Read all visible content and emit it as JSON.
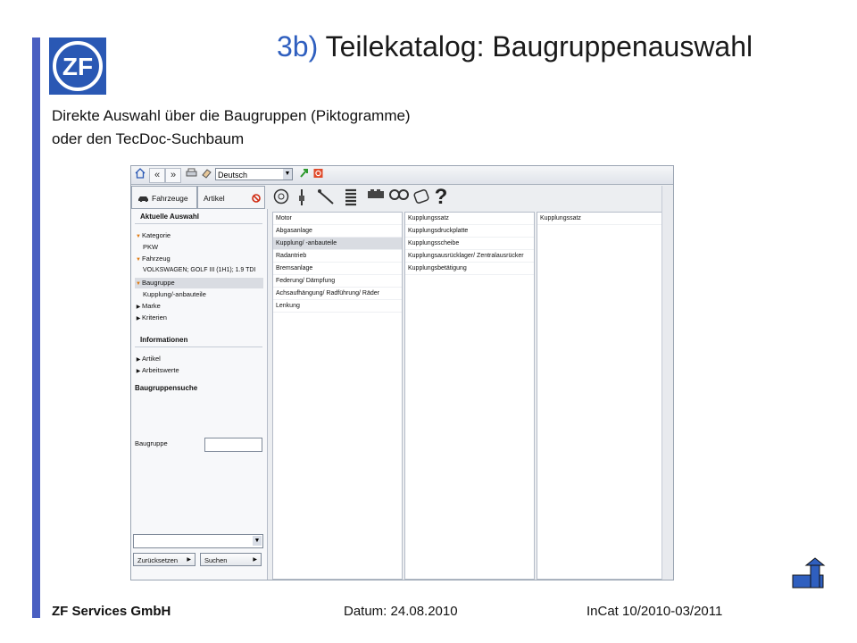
{
  "header": {
    "logo_text": "ZF",
    "title_number": "3b)",
    "title_text": "Teilekatalog: Baugruppenauswahl"
  },
  "subtitle": {
    "line1": "Direkte Auswahl über die Baugruppen (Piktogramme)",
    "line2": "oder den TecDoc-Suchbaum"
  },
  "app": {
    "toolbar": {
      "home_icon": "home-icon",
      "back_label": "«",
      "forward_label": "»",
      "print_icon": "print-icon",
      "eraser_icon": "eraser-icon",
      "language_value": "Deutsch",
      "refresh_icon": "refresh-icon",
      "exit_icon": "exit-icon"
    },
    "tabs": {
      "vehicles_label": "Fahrzeuge",
      "articles_label": "Artikel"
    },
    "left": {
      "current_selection_heading": "Aktuelle Auswahl",
      "tree": [
        {
          "label": "Kategorie",
          "expanded": true
        },
        {
          "label": "PKW",
          "child": true
        },
        {
          "label": "Fahrzeug",
          "expanded": true
        },
        {
          "label": "VOLKSWAGEN; GOLF III (1H1); 1.9 TDI",
          "child": true
        },
        {
          "label": "Baugruppe",
          "expanded": true,
          "selected": true
        },
        {
          "label": "Kupplung/-anbauteile",
          "child": true
        },
        {
          "label": "Marke",
          "expanded": false
        },
        {
          "label": "Kriterien",
          "expanded": false
        }
      ],
      "info_heading": "Informationen",
      "info_items": [
        "Artikel",
        "Arbeitswerte"
      ],
      "search_heading": "Baugruppensuche",
      "search_label": "Baugruppe",
      "search_value": "",
      "reset_button": "Zurücksetzen",
      "search_button": "Suchen"
    },
    "pictograms": [
      "brake-disc-icon",
      "shock-absorber-icon",
      "steering-icon",
      "spring-icon",
      "engine-icon",
      "clutch-icon",
      "filter-icon",
      "help-icon"
    ],
    "columns": [
      [
        "Motor",
        "Abgasanlage",
        "Kupplung/ -anbauteile",
        "Radantrieb",
        "Bremsanlage",
        "Federung/ Dämpfung",
        "Achsaufhängung/ Radführung/ Räder",
        "Lenkung"
      ],
      [
        "Kupplungssatz",
        "Kupplungsdruckplatte",
        "Kupplungsscheibe",
        "Kupplungsausrücklager/ Zentralausrücker",
        "Kupplungsbetätigung"
      ],
      [
        "Kupplungssatz"
      ]
    ],
    "selected_column0_index": 2
  },
  "footer": {
    "company": "ZF Services GmbH",
    "date": "Datum: 24.08.2010",
    "version": "InCat 10/2010-03/2011"
  },
  "colors": {
    "accent_blue": "#4a5fc1",
    "logo_blue": "#2a58b4",
    "title_number_blue": "#2f5fbf"
  }
}
